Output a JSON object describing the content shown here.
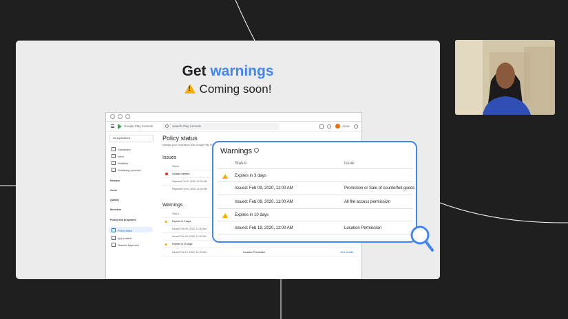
{
  "slide": {
    "title_part1": "Get ",
    "title_part2": "warnings",
    "subtitle": "Coming soon!"
  },
  "console": {
    "app_name": "Google Play Console",
    "search_placeholder": "Search Play Console",
    "user_name": "Anna",
    "sidebar": {
      "all_apps": "All applications",
      "items": [
        "Dashboard",
        "Inbox",
        "Statistics",
        "Publishing overview"
      ],
      "sections": [
        "Release",
        "Grow",
        "Quality",
        "Monetize",
        "Policy and programs"
      ],
      "policy_items": [
        "Policy status",
        "App content",
        "Teacher Approved"
      ]
    },
    "policy_title": "Policy status",
    "policy_subtitle": "Manage your compliance with Google Play Policy",
    "issues_title": "Issues",
    "issues_status_header": "Status",
    "issues_rows": [
      "Update rejected",
      "Rejected Oct 9, 2020, 11:00 AM",
      "Rejected Oct 9, 2020, 11:00 AM"
    ],
    "warnings_title": "Warnings",
    "warnings_status_header": "Status",
    "warnings_rows": [
      "Expires in 3 days",
      "Issued Feb 09, 2020, 11:00 AM",
      "Issued Feb 09, 2020, 11:00 AM",
      "Expires in 10 days",
      "Issued Feb 19, 2020, 11:00 AM"
    ],
    "last_issue": "Location Permission",
    "view_details": "View details"
  },
  "warnings_card": {
    "title": "Warnings",
    "col_status": "Status",
    "col_issue": "Issue",
    "group1": "Expires in 3 days",
    "row1_issued": "Issued: Feb 09, 2020, 11:00 AM",
    "row1_issue": "Promotion or Sale of counterfeit goods",
    "row2_issued": "Issued: Feb 09, 2020, 11:00 AM",
    "row2_issue": "All file access permission",
    "group2": "Expires in 10 days",
    "row3_issued": "Issued: Feb 19, 2020, 11:00 AM",
    "row3_issue": "Location Permission"
  },
  "colors": {
    "accent": "#4285f4",
    "warning": "#f9ab00",
    "error": "#d93025",
    "background": "#1f1f1f"
  }
}
